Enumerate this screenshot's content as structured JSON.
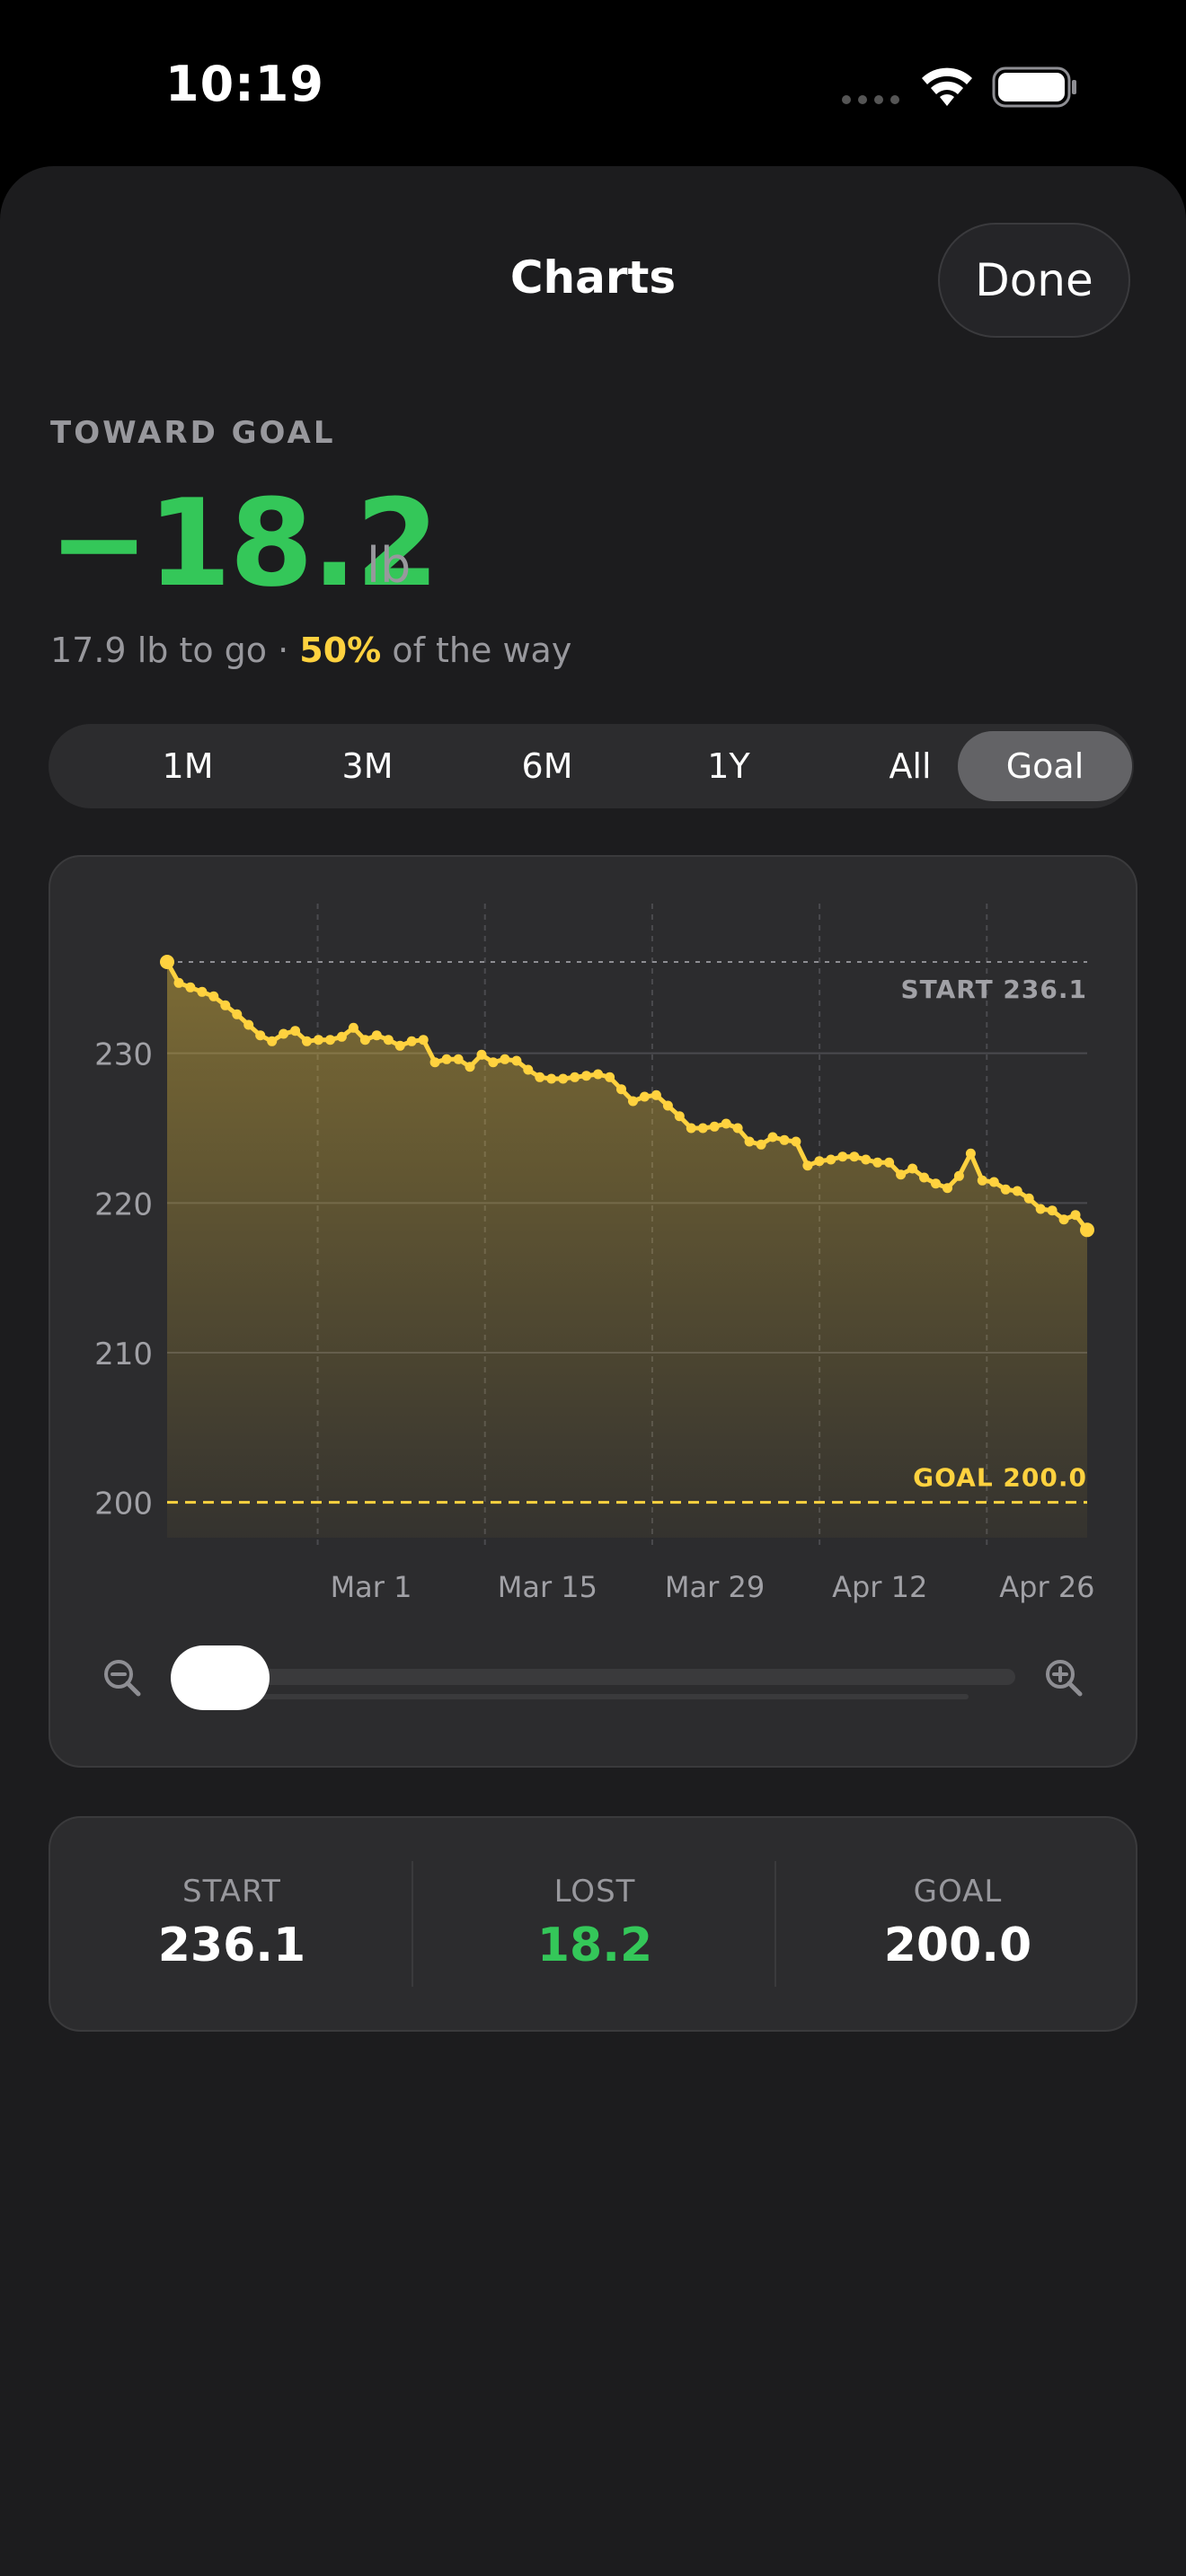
{
  "status_bar": {
    "time": "10:19"
  },
  "header": {
    "title": "Charts",
    "done_label": "Done"
  },
  "summary": {
    "label": "TOWARD GOAL",
    "change": "−18.2",
    "unit": "lb",
    "remaining": "17.9 lb to go · ",
    "percent": "50%",
    "percent_suffix": " of the way"
  },
  "ranges": [
    {
      "label": "1M",
      "active": false
    },
    {
      "label": "3M",
      "active": false
    },
    {
      "label": "6M",
      "active": false
    },
    {
      "label": "1Y",
      "active": false
    },
    {
      "label": "All",
      "active": false
    },
    {
      "label": "Goal",
      "active": true
    }
  ],
  "chart_data": {
    "type": "area",
    "series": [
      {
        "values": [
          236.1,
          234.7,
          234.4,
          234.1,
          233.8,
          233.2,
          232.6,
          231.9,
          231.2,
          230.8,
          231.3,
          231.5,
          230.8,
          230.9,
          230.9,
          231.1,
          231.7,
          230.9,
          231.2,
          230.9,
          230.5,
          230.8,
          230.9,
          229.4,
          229.6,
          229.6,
          229.1,
          229.9,
          229.4,
          229.6,
          229.5,
          228.9,
          228.4,
          228.3,
          228.3,
          228.4,
          228.5,
          228.6,
          228.4,
          227.6,
          226.8,
          227.1,
          227.2,
          226.5,
          225.8,
          225.0,
          225.0,
          225.1,
          225.3,
          225.0,
          224.1,
          223.9,
          224.4,
          224.2,
          224.1,
          222.5,
          222.8,
          222.9,
          223.1,
          223.1,
          222.9,
          222.7,
          222.7,
          221.9,
          222.3,
          221.7,
          221.3,
          221.0,
          221.8,
          223.3,
          221.5,
          221.4,
          220.9,
          220.8,
          220.3,
          219.6,
          219.5,
          218.9,
          219.2,
          218.2
        ],
        "color": "#ffd23f"
      }
    ],
    "x_tick_labels": [
      "Mar 1",
      "Mar 15",
      "Mar 29",
      "Apr 12",
      "Apr 26"
    ],
    "y_ticks": [
      200,
      210,
      220,
      230
    ],
    "ylim": [
      198,
      240
    ],
    "start": {
      "value": 236.1,
      "label": "START 236.1"
    },
    "goal": {
      "value": 200.0,
      "label": "GOAL 200.0"
    },
    "grid": true,
    "colors": {
      "line": "#ffd23f",
      "goal": "#ffd23f",
      "start": "#8e8e93"
    }
  },
  "stats": {
    "start": {
      "label": "START",
      "value": "236.1"
    },
    "lost": {
      "label": "LOST",
      "value": "18.2"
    },
    "goal": {
      "label": "GOAL",
      "value": "200.0"
    }
  },
  "icons": {
    "zoom_out": "zoom-out-icon",
    "zoom_in": "zoom-in-icon",
    "wifi": "wifi-icon",
    "battery": "battery-icon"
  }
}
